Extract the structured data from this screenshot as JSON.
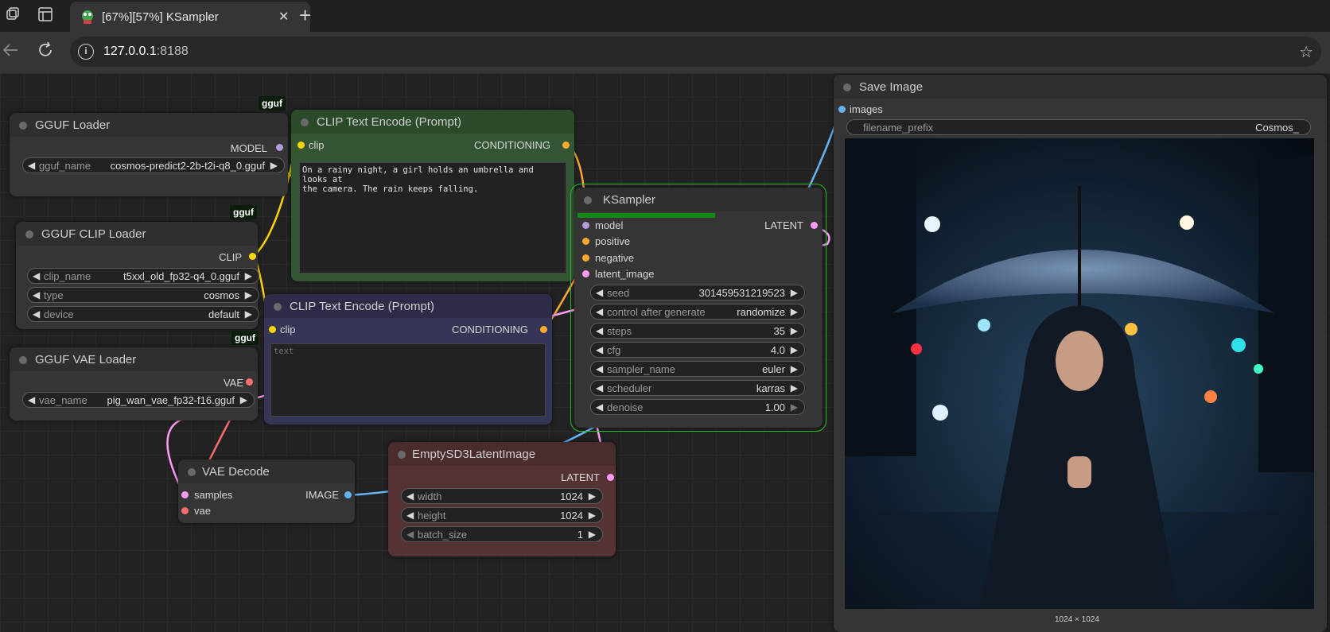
{
  "browser": {
    "tab_title": "[67%][57%] KSampler",
    "close_glyph": "✕",
    "new_tab_glyph": "+",
    "url_host": "127.0.0.1",
    "url_port": ":8188"
  },
  "nodes": {
    "gguf_loader": {
      "badge": "gguf",
      "title": "GGUF Loader",
      "output": "MODEL",
      "widget": {
        "label": "gguf_name",
        "value": "cosmos-predict2-2b-t2i-q8_0.gguf"
      }
    },
    "clip_loader": {
      "badge": "gguf",
      "title": "GGUF CLIP Loader",
      "output": "CLIP",
      "widgets": [
        {
          "label": "clip_name",
          "value": "t5xxl_old_fp32-q4_0.gguf"
        },
        {
          "label": "type",
          "value": "cosmos"
        },
        {
          "label": "device",
          "value": "default"
        }
      ]
    },
    "vae_loader": {
      "badge": "gguf",
      "title": "GGUF VAE Loader",
      "output": "VAE",
      "widget": {
        "label": "vae_name",
        "value": "pig_wan_vae_fp32-f16.gguf"
      }
    },
    "clip_pos": {
      "title": "CLIP Text Encode (Prompt)",
      "input": "clip",
      "output": "CONDITIONING",
      "text": "On a rainy night, a girl holds an umbrella and looks at\nthe camera. The rain keeps falling."
    },
    "clip_neg": {
      "title": "CLIP Text Encode (Prompt)",
      "input": "clip",
      "output": "CONDITIONING",
      "placeholder": "text"
    },
    "ksampler": {
      "title": "KSampler",
      "progress": 0.57,
      "inputs": [
        "model",
        "positive",
        "negative",
        "latent_image"
      ],
      "output": "LATENT",
      "widgets": [
        {
          "label": "seed",
          "value": "301459531219523"
        },
        {
          "label": "control after generate",
          "value": "randomize"
        },
        {
          "label": "steps",
          "value": "35"
        },
        {
          "label": "cfg",
          "value": "4.0"
        },
        {
          "label": "sampler_name",
          "value": "euler"
        },
        {
          "label": "scheduler",
          "value": "karras"
        },
        {
          "label": "denoise",
          "value": "1.00"
        }
      ]
    },
    "vae_decode": {
      "title": "VAE Decode",
      "inputs": [
        "samples",
        "vae"
      ],
      "output": "IMAGE"
    },
    "empty_latent": {
      "title": "EmptySD3LatentImage",
      "output": "LATENT",
      "widgets": [
        {
          "label": "width",
          "value": "1024"
        },
        {
          "label": "height",
          "value": "1024"
        },
        {
          "label": "batch_size",
          "value": "1"
        }
      ]
    },
    "save_image": {
      "title": "Save Image",
      "input": "images",
      "widget": {
        "label": "filename_prefix",
        "value": "Cosmos_"
      },
      "image_caption": "1024 × 1024"
    }
  },
  "colors": {
    "model": "#b39ddb",
    "clip": "#ffd500",
    "conditioning": "#ffa931",
    "latent": "#ff9cf9",
    "vae": "#ff6e6e",
    "image": "#64b5f6"
  }
}
